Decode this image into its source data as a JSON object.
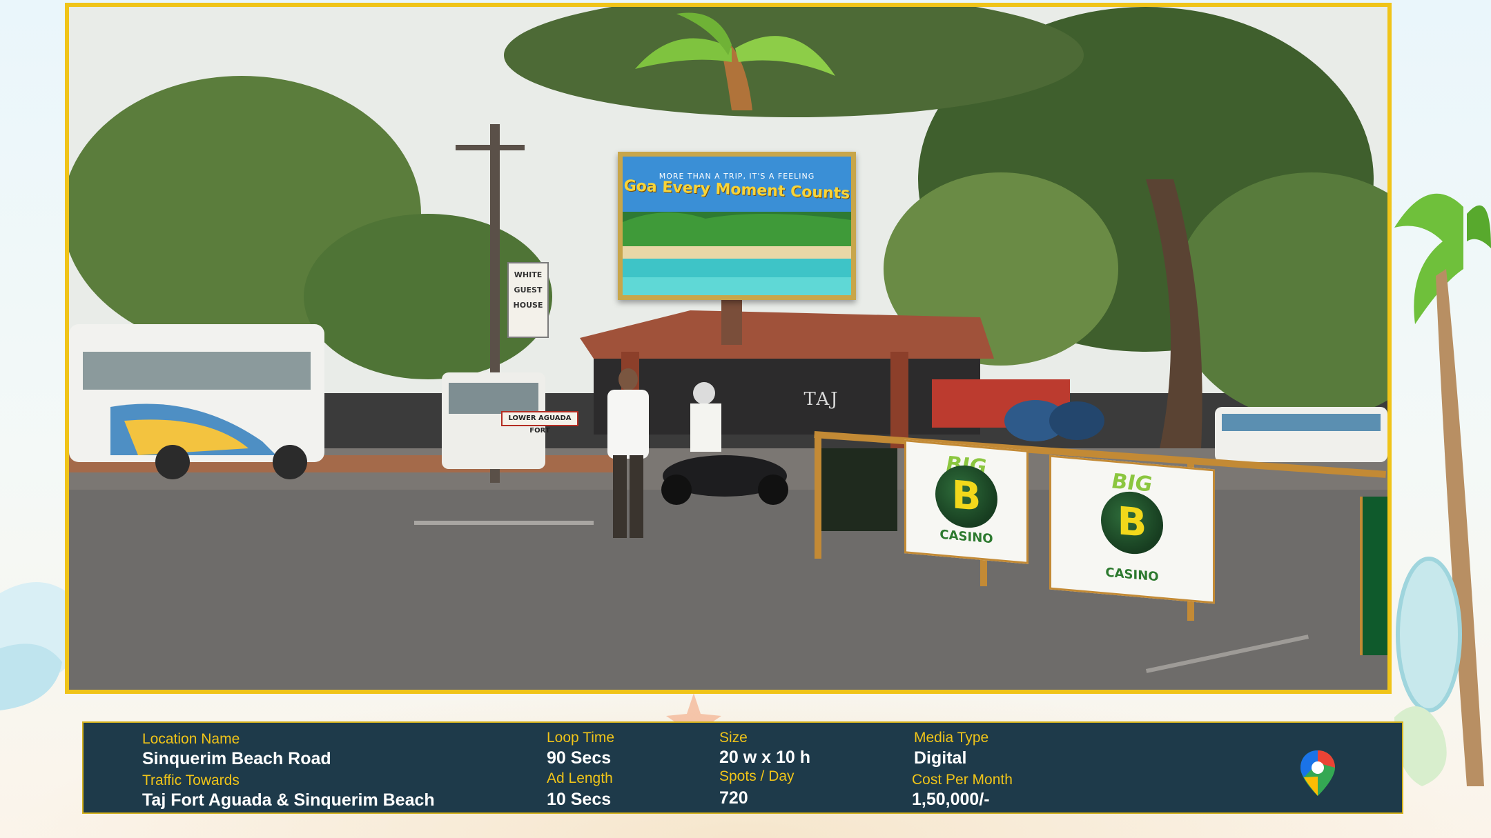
{
  "photo": {
    "billboard": {
      "tagline": "MORE THAN A TRIP, IT'S A FEELING",
      "title": "Goa Every Moment Counts"
    },
    "signs": {
      "guest_house": "WHITE\nGUEST\nHOUSE",
      "fort": "LOWER AGUADA FORT",
      "taj": "TAJ"
    },
    "banner_brand": "BIG",
    "banner_letter": "B",
    "banner_sub": "CASINO"
  },
  "info": {
    "location_label": "Location Name",
    "location_value": "Sinquerim Beach Road",
    "traffic_label": "Traffic Towards",
    "traffic_value": "Taj Fort Aguada & Sinquerim Beach",
    "loop_label": "Loop Time",
    "loop_value": "90 Secs",
    "adlength_label": "Ad Length",
    "adlength_value": "10 Secs",
    "size_label": "Size",
    "size_value": "20 w x 10 h",
    "spots_label": "Spots / Day",
    "spots_value": "720",
    "media_label": "Media Type",
    "media_value": "Digital",
    "cost_label": "Cost Per Month",
    "cost_value": "1,50,000/-"
  },
  "icons": {
    "maps": "google-maps-pin-icon"
  },
  "colors": {
    "frame": "#f0c419",
    "info_bg": "#1e3a4a",
    "label": "#f0c419",
    "value": "#ffffff"
  }
}
